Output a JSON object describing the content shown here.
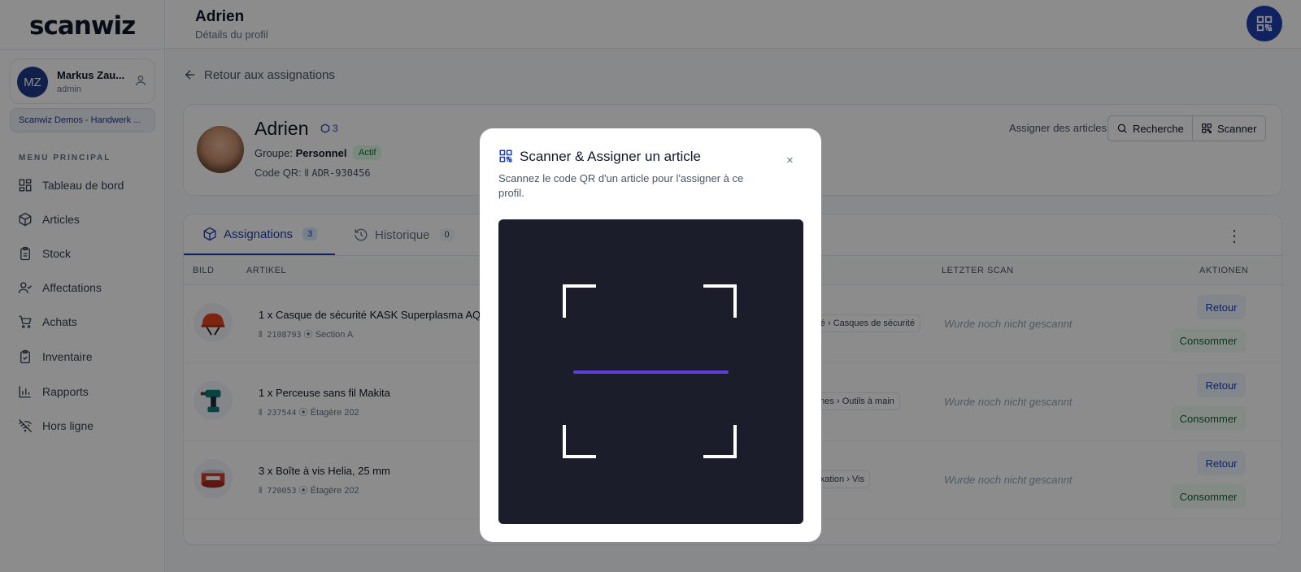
{
  "brand": {
    "logo": "scanwiz"
  },
  "user": {
    "initials": "MZ",
    "name": "Markus Zau...",
    "role": "admin"
  },
  "org": "Scanwiz Demos - Handwerk ...",
  "sidebar": {
    "menu_title": "MENU PRINCIPAL",
    "items": [
      {
        "label": "Tableau de bord",
        "icon": "dashboard-icon"
      },
      {
        "label": "Articles",
        "icon": "box-icon"
      },
      {
        "label": "Stock",
        "icon": "clipboard-icon"
      },
      {
        "label": "Affectations",
        "icon": "user-check-icon"
      },
      {
        "label": "Achats",
        "icon": "cart-icon"
      },
      {
        "label": "Inventaire",
        "icon": "clipboard-check-icon"
      },
      {
        "label": "Rapports",
        "icon": "bar-chart-icon"
      },
      {
        "label": "Hors ligne",
        "icon": "wifi-off-icon"
      }
    ]
  },
  "header": {
    "title": "Adrien",
    "subtitle": "Détails du profil"
  },
  "back_link": "Retour aux assignations",
  "profile": {
    "name": "Adrien",
    "count": "3",
    "group_label": "Groupe:",
    "group_value": "Personnel",
    "status": "Actif",
    "qr_label": "Code QR:",
    "qr_value": "ADR-930456",
    "assign_label": "Assigner des articles",
    "search_btn": "Recherche",
    "scan_btn": "Scanner"
  },
  "tabs": [
    {
      "label": "Assignations",
      "count": "3"
    },
    {
      "label": "Historique",
      "count": "0"
    }
  ],
  "table": {
    "headers": {
      "image": "BILD",
      "article": "ARTIKEL",
      "last_scan": "LETZTER SCAN",
      "actions": "AKTIONEN"
    },
    "rows": [
      {
        "title": "1 x Casque de sécurité KASK Superplasma AQ",
        "code": "2108793",
        "location": "Section A",
        "category": "curité › Casques de sécurité",
        "scan": "Wurde noch nicht gescannt"
      },
      {
        "title": "1 x Perceuse sans fil Makita",
        "code": "237544",
        "location": "Étagère 202",
        "category": "achines › Outils à main",
        "scan": "Wurde noch nicht gescannt"
      },
      {
        "title": "3 x Boîte à vis Helia, 25 mm",
        "code": "720053",
        "location": "Étagère 202",
        "category": "de fixation › Vis",
        "scan": "Wurde noch nicht gescannt"
      }
    ],
    "btn_return": "Retour",
    "btn_consume": "Consommer"
  },
  "modal": {
    "title": "Scanner & Assigner un article",
    "description": "Scannez le code QR d'un article pour l'assigner à ce profil.",
    "close": "×"
  },
  "colors": {
    "primary": "#1e40af",
    "scanline": "#5b3fd6",
    "scanner_bg": "#1b1d2b",
    "success": "#166534"
  }
}
